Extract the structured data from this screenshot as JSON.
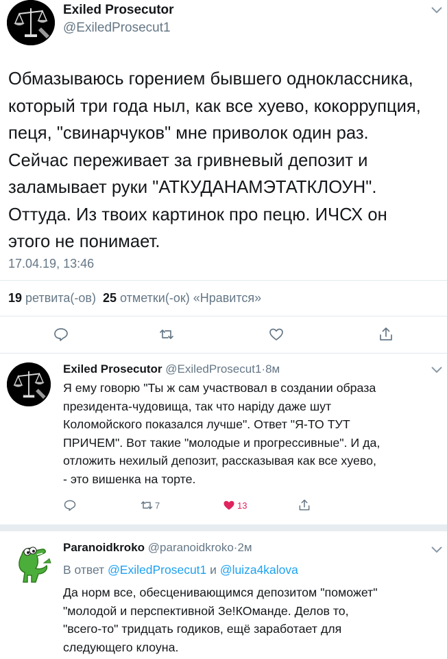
{
  "main_tweet": {
    "name": "Exiled Prosecutor",
    "handle": "@ExiledProsecut1",
    "text": "Обмазываюсь горением бывшего одноклассника,\nкоторый три года ныл, как все хуево, кокоррупция,\nпеця, \"свинарчуков\" мне приволок один раз.\nСейчас переживает за гривневый депозит и\nзаламывает руки \"АТКУДАНАМЭТАТКЛОУН\".\nОттуда. Из твоих картинок про пецю. ИЧСХ он\nэтого не понимает.",
    "timestamp": "17.04.19, 13:46",
    "retweets_count": "19",
    "retweets_label": "ретвита(-ов)",
    "likes_count": "25",
    "likes_label": "отметки(-ок) «Нравится»"
  },
  "replies": [
    {
      "name": "Exiled Prosecutor",
      "handle": "@ExiledProsecut1",
      "time": "8м",
      "text": "Я ему говорю \"Ты ж сам участвовал в создании образа\nпрезидента-чудовища, так что наріду даже шут\nКоломойского показался лучше\". Ответ \"Я-ТО ТУТ\nПРИЧЕМ\". Вот такие \"молодые и прогрессивные\". И да,\nотложить нехилый депозит, рассказывая как все хуево,\n- это вишенка на торте.",
      "retweet_count": "7",
      "like_count": "13"
    },
    {
      "name": "Paranoidkroko",
      "handle": "@paranoidkroko",
      "time": "2м",
      "reply_prefix": "В ответ",
      "reply_user1": "@ExiledProsecut1",
      "reply_and": "и",
      "reply_user2": "@luiza4kalova",
      "text": "Да норм все, обесценивающимся депозитом \"поможет\"\n\"молодой и перспективной Зе!КОманде. Делов то,\n\"всего-то\" тридцать годиков, ещё заработает для\nследующего клоуна."
    }
  ],
  "separator": "·",
  "colors": {
    "text": "#14171a",
    "secondary": "#657786",
    "link": "#1da1f2",
    "like_active": "#e0245e",
    "divider": "#e1e8ed"
  },
  "icons": [
    "reply-icon",
    "retweet-icon",
    "like-icon",
    "share-icon",
    "chevron-down-icon"
  ]
}
